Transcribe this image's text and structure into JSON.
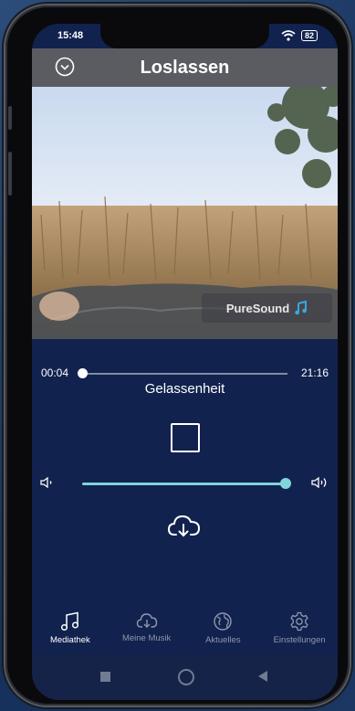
{
  "status": {
    "time": "15:48",
    "battery": "82"
  },
  "header": {
    "title": "Loslassen"
  },
  "badge": {
    "text": "PureSound"
  },
  "player": {
    "elapsed": "00:04",
    "duration": "21:16",
    "progress": 0.003,
    "track_title": "Gelassenheit",
    "volume": 0.97
  },
  "nav": {
    "items": [
      {
        "label": "Mediathek",
        "icon": "music-note-icon",
        "active": true
      },
      {
        "label": "Meine Musik",
        "icon": "cloud-download-icon",
        "active": false
      },
      {
        "label": "Aktuelles",
        "icon": "globe-icon",
        "active": false
      },
      {
        "label": "Einstellungen",
        "icon": "gear-icon",
        "active": false
      }
    ]
  },
  "colors": {
    "accent": "#7fd5d8",
    "background": "#12224e",
    "header": "#5a5c62"
  }
}
